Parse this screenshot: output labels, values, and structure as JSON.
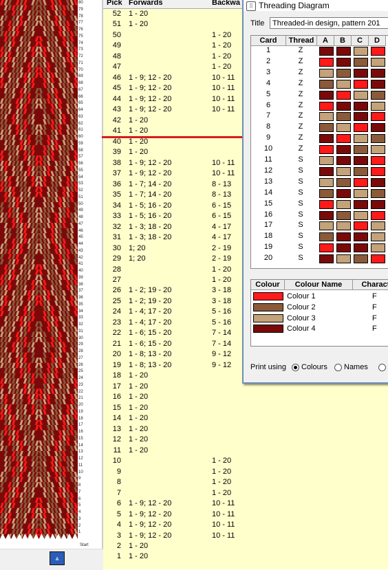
{
  "headers": {
    "pick": "Pick",
    "forwards": "Forwards",
    "backwards": "Backwa"
  },
  "picks": [
    {
      "pick": "52",
      "fw": "1 - 20",
      "bw": ""
    },
    {
      "pick": "51",
      "fw": "1 - 20",
      "bw": ""
    },
    {
      "pick": "50",
      "fw": "",
      "bw": "1 - 20"
    },
    {
      "pick": "49",
      "fw": "",
      "bw": "1 - 20"
    },
    {
      "pick": "48",
      "fw": "",
      "bw": "1 - 20"
    },
    {
      "pick": "47",
      "fw": "",
      "bw": "1 - 20"
    },
    {
      "pick": "46",
      "fw": "1 - 9; 12 - 20",
      "bw": "10 - 11"
    },
    {
      "pick": "45",
      "fw": "1 - 9; 12 - 20",
      "bw": "10 - 11"
    },
    {
      "pick": "44",
      "fw": "1 - 9; 12 - 20",
      "bw": "10 - 11"
    },
    {
      "pick": "43",
      "fw": "1 - 9; 12 - 20",
      "bw": "10 - 11"
    },
    {
      "pick": "42",
      "fw": "1 - 20",
      "bw": ""
    },
    {
      "pick": "41",
      "fw": "1 - 20",
      "bw": ""
    },
    {
      "pick": "40",
      "fw": "1 - 20",
      "bw": ""
    },
    {
      "pick": "39",
      "fw": "1 - 20",
      "bw": ""
    },
    {
      "pick": "38",
      "fw": "1 - 9; 12 - 20",
      "bw": "10 - 11"
    },
    {
      "pick": "37",
      "fw": "1 - 9; 12 - 20",
      "bw": "10 - 11"
    },
    {
      "pick": "36",
      "fw": "1 - 7; 14 - 20",
      "bw": "8 - 13"
    },
    {
      "pick": "35",
      "fw": "1 - 7; 14 - 20",
      "bw": "8 - 13"
    },
    {
      "pick": "34",
      "fw": "1 - 5; 16 - 20",
      "bw": "6 - 15"
    },
    {
      "pick": "33",
      "fw": "1 - 5; 16 - 20",
      "bw": "6 - 15"
    },
    {
      "pick": "32",
      "fw": "1 - 3; 18 - 20",
      "bw": "4 - 17"
    },
    {
      "pick": "31",
      "fw": "1 - 3; 18 - 20",
      "bw": "4 - 17"
    },
    {
      "pick": "30",
      "fw": "1; 20",
      "bw": "2 - 19"
    },
    {
      "pick": "29",
      "fw": "1; 20",
      "bw": "2 - 19"
    },
    {
      "pick": "28",
      "fw": "",
      "bw": "1 - 20"
    },
    {
      "pick": "27",
      "fw": "",
      "bw": "1 - 20"
    },
    {
      "pick": "26",
      "fw": "1 - 2; 19 - 20",
      "bw": "3 - 18"
    },
    {
      "pick": "25",
      "fw": "1 - 2; 19 - 20",
      "bw": "3 - 18"
    },
    {
      "pick": "24",
      "fw": "1 - 4; 17 - 20",
      "bw": "5 - 16"
    },
    {
      "pick": "23",
      "fw": "1 - 4; 17 - 20",
      "bw": "5 - 16"
    },
    {
      "pick": "22",
      "fw": "1 - 6; 15 - 20",
      "bw": "7 - 14"
    },
    {
      "pick": "21",
      "fw": "1 - 6; 15 - 20",
      "bw": "7 - 14"
    },
    {
      "pick": "20",
      "fw": "1 - 8; 13 - 20",
      "bw": "9 - 12"
    },
    {
      "pick": "19",
      "fw": "1 - 8; 13 - 20",
      "bw": "9 - 12"
    },
    {
      "pick": "18",
      "fw": "1 - 20",
      "bw": ""
    },
    {
      "pick": "17",
      "fw": "1 - 20",
      "bw": ""
    },
    {
      "pick": "16",
      "fw": "1 - 20",
      "bw": ""
    },
    {
      "pick": "15",
      "fw": "1 - 20",
      "bw": ""
    },
    {
      "pick": "14",
      "fw": "1 - 20",
      "bw": ""
    },
    {
      "pick": "13",
      "fw": "1 - 20",
      "bw": ""
    },
    {
      "pick": "12",
      "fw": "1 - 20",
      "bw": ""
    },
    {
      "pick": "11",
      "fw": "1 - 20",
      "bw": ""
    },
    {
      "pick": "10",
      "fw": "",
      "bw": "1 - 20"
    },
    {
      "pick": "9",
      "fw": "",
      "bw": "1 - 20"
    },
    {
      "pick": "8",
      "fw": "",
      "bw": "1 - 20"
    },
    {
      "pick": "7",
      "fw": "",
      "bw": "1 - 20"
    },
    {
      "pick": "6",
      "fw": "1 - 9; 12 - 20",
      "bw": "10 - 11"
    },
    {
      "pick": "5",
      "fw": "1 - 9; 12 - 20",
      "bw": "10 - 11"
    },
    {
      "pick": "4",
      "fw": "1 - 9; 12 - 20",
      "bw": "10 - 11"
    },
    {
      "pick": "3",
      "fw": "1 - 9; 12 - 20",
      "bw": "10 - 11"
    },
    {
      "pick": "2",
      "fw": "1 - 20",
      "bw": ""
    },
    {
      "pick": "1",
      "fw": "1 - 20",
      "bw": ""
    }
  ],
  "ruler_numbers": [
    "80",
    "79",
    "78",
    "77",
    "76",
    "75",
    "74",
    "73",
    "72",
    "71",
    "70",
    "69",
    "68",
    "67",
    "66",
    "65",
    "64",
    "63",
    "62",
    "61",
    "60",
    "59",
    "58",
    "57",
    "56",
    "55",
    "54",
    "53",
    "52",
    "51",
    "50",
    "49",
    "48",
    "47",
    "46",
    "45",
    "44",
    "43",
    "42",
    "41",
    "40",
    "39",
    "38",
    "37",
    "36",
    "35",
    "34",
    "33",
    "32",
    "31",
    "30",
    "29",
    "28",
    "27",
    "26",
    "25",
    "24",
    "23",
    "22",
    "21",
    "20",
    "19",
    "18",
    "17",
    "16",
    "15",
    "14",
    "13",
    "12",
    "11",
    "10",
    "9",
    "8",
    "7",
    "6",
    "5",
    "4",
    "3",
    "2",
    "1"
  ],
  "ruler_label": "Start",
  "weave_colors": {
    "c1": "#ff1a1a",
    "c2": "#8b5a3a",
    "c3": "#c4a27a",
    "c4": "#7a0a0a"
  },
  "dialog": {
    "title": "Threading Diagram",
    "title_label": "Title",
    "title_value": "Threaded-in design, pattern 201",
    "cols": {
      "card": "Card",
      "thread": "Thread",
      "a": "A",
      "b": "B",
      "c": "C",
      "d": "D"
    },
    "cards": [
      {
        "card": "1",
        "thread": "Z",
        "holes": [
          "c4",
          "c4",
          "c3",
          "c1"
        ]
      },
      {
        "card": "2",
        "thread": "Z",
        "holes": [
          "c1",
          "c4",
          "c2",
          "c3"
        ]
      },
      {
        "card": "3",
        "thread": "Z",
        "holes": [
          "c3",
          "c2",
          "c4",
          "c4"
        ]
      },
      {
        "card": "4",
        "thread": "Z",
        "holes": [
          "c2",
          "c3",
          "c1",
          "c4"
        ]
      },
      {
        "card": "5",
        "thread": "Z",
        "holes": [
          "c4",
          "c1",
          "c3",
          "c2"
        ]
      },
      {
        "card": "6",
        "thread": "Z",
        "holes": [
          "c1",
          "c4",
          "c4",
          "c3"
        ]
      },
      {
        "card": "7",
        "thread": "Z",
        "holes": [
          "c3",
          "c2",
          "c4",
          "c1"
        ]
      },
      {
        "card": "8",
        "thread": "Z",
        "holes": [
          "c2",
          "c3",
          "c1",
          "c4"
        ]
      },
      {
        "card": "9",
        "thread": "Z",
        "holes": [
          "c4",
          "c1",
          "c3",
          "c2"
        ]
      },
      {
        "card": "10",
        "thread": "Z",
        "holes": [
          "c1",
          "c4",
          "c2",
          "c3"
        ]
      },
      {
        "card": "11",
        "thread": "S",
        "holes": [
          "c3",
          "c4",
          "c4",
          "c1"
        ]
      },
      {
        "card": "12",
        "thread": "S",
        "holes": [
          "c4",
          "c3",
          "c2",
          "c1"
        ]
      },
      {
        "card": "13",
        "thread": "S",
        "holes": [
          "c3",
          "c2",
          "c1",
          "c4"
        ]
      },
      {
        "card": "14",
        "thread": "S",
        "holes": [
          "c2",
          "c4",
          "c3",
          "c2"
        ]
      },
      {
        "card": "15",
        "thread": "S",
        "holes": [
          "c1",
          "c3",
          "c4",
          "c4"
        ]
      },
      {
        "card": "16",
        "thread": "S",
        "holes": [
          "c4",
          "c2",
          "c3",
          "c1"
        ]
      },
      {
        "card": "17",
        "thread": "S",
        "holes": [
          "c3",
          "c3",
          "c1",
          "c3"
        ]
      },
      {
        "card": "18",
        "thread": "S",
        "holes": [
          "c2",
          "c4",
          "c4",
          "c3"
        ]
      },
      {
        "card": "19",
        "thread": "S",
        "holes": [
          "c1",
          "c4",
          "c4",
          "c3"
        ]
      },
      {
        "card": "20",
        "thread": "S",
        "holes": [
          "c4",
          "c3",
          "c2",
          "c1"
        ]
      }
    ],
    "colour_cols": {
      "colour": "Colour",
      "name": "Colour Name",
      "char": "Characte"
    },
    "colours": [
      {
        "key": "c1",
        "name": "Colour 1",
        "char": "F"
      },
      {
        "key": "c2",
        "name": "Colour 2",
        "char": "F"
      },
      {
        "key": "c3",
        "name": "Colour 3",
        "char": "F"
      },
      {
        "key": "c4",
        "name": "Colour 4",
        "char": "F"
      }
    ],
    "print_label": "Print using",
    "print_options": [
      {
        "label": "Colours",
        "selected": true
      },
      {
        "label": "Names",
        "selected": false
      },
      {
        "label": "",
        "selected": false
      }
    ]
  }
}
